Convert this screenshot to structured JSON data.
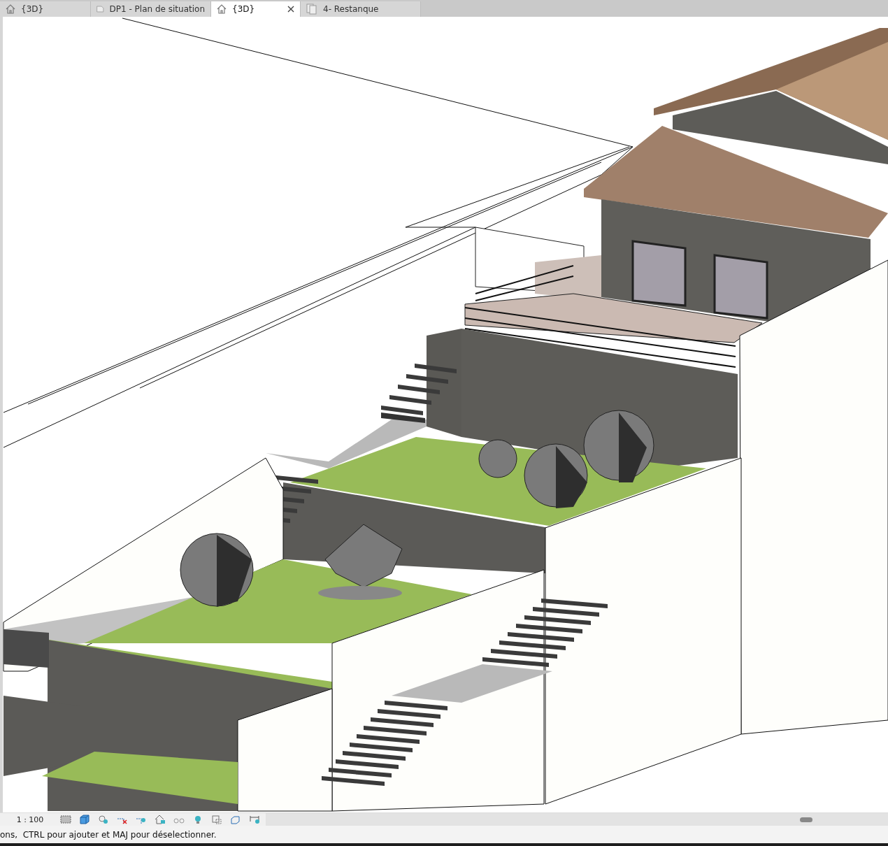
{
  "tabs": [
    {
      "label": "{3D}",
      "kind": "view3d",
      "selected": false
    },
    {
      "label": "DP1 - Plan de situation",
      "kind": "sheet",
      "selected": false
    },
    {
      "label": "{3D}",
      "kind": "view3d",
      "selected": true
    },
    {
      "label": "4- Restanque",
      "kind": "sheets",
      "selected": false
    }
  ],
  "view_control_bar": {
    "scale": "1 : 100"
  },
  "status_bar": {
    "message": "ons,  CTRL pour ajouter et MAJ pour déselectionner."
  }
}
